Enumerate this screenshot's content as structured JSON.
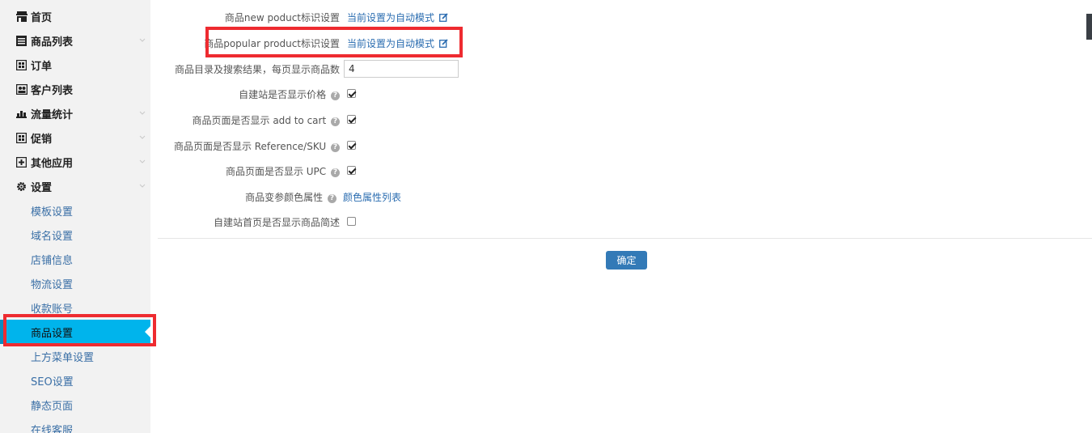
{
  "sidebar": {
    "items": [
      {
        "label": "首页",
        "icon": "store-icon",
        "chevron": false
      },
      {
        "label": "商品列表",
        "icon": "list-icon",
        "chevron": true
      },
      {
        "label": "订单",
        "icon": "grid-icon",
        "chevron": false
      },
      {
        "label": "客户列表",
        "icon": "users-icon",
        "chevron": false
      },
      {
        "label": "流量统计",
        "icon": "bar-chart-icon",
        "chevron": true
      },
      {
        "label": "促销",
        "icon": "grid-icon",
        "chevron": true
      },
      {
        "label": "其他应用",
        "icon": "plus-square-icon",
        "chevron": true
      },
      {
        "label": "设置",
        "icon": "gear-icon",
        "chevron": true
      }
    ],
    "sub_items": [
      {
        "label": "模板设置"
      },
      {
        "label": "域名设置"
      },
      {
        "label": "店铺信息"
      },
      {
        "label": "物流设置"
      },
      {
        "label": "收款账号"
      },
      {
        "label": "商品设置",
        "active": true
      },
      {
        "label": "上方菜单设置"
      },
      {
        "label": "SEO设置"
      },
      {
        "label": "静态页面"
      },
      {
        "label": "在线客服"
      }
    ]
  },
  "form": {
    "new_product": {
      "label": "商品new poduct标识设置",
      "link": "当前设置为自动模式"
    },
    "popular_product": {
      "label": "商品popular product标识设置",
      "link": "当前设置为自动模式"
    },
    "per_page": {
      "label": "商品目录及搜索结果，每页显示商品数",
      "value": "4"
    },
    "show_price": {
      "label": "自建站是否显示价格",
      "checked": true
    },
    "show_add_to_cart": {
      "label": "商品页面是否显示 add to cart",
      "checked": true
    },
    "show_reference_sku": {
      "label": "商品页面是否显示 Reference/SKU",
      "checked": true
    },
    "show_upc": {
      "label": "商品页面是否显示 UPC",
      "checked": true
    },
    "color_attribute": {
      "label": "商品变参颜色属性",
      "link": "颜色属性列表"
    },
    "show_home_desc": {
      "label": "自建站首页是否显示商品简述",
      "checked": false
    },
    "submit_label": "确定"
  },
  "colors": {
    "active_bg": "#00b4ec",
    "link": "#2a6cb0",
    "highlight": "#ee2b30",
    "button": "#337ab7"
  }
}
